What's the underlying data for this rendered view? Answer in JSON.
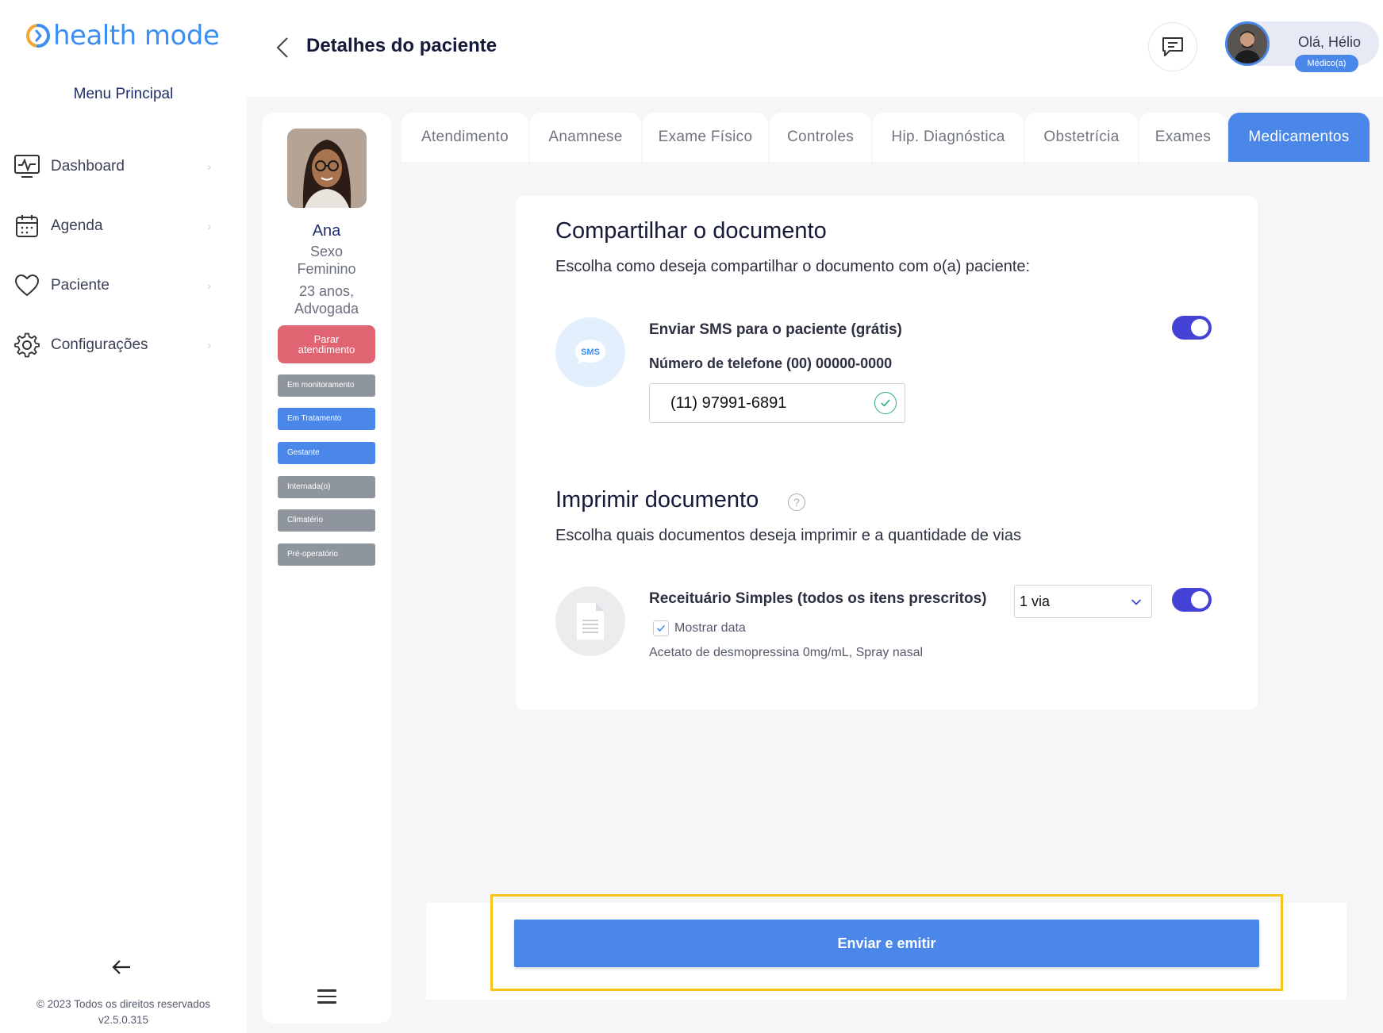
{
  "brand": {
    "name": "health mode",
    "color": "#3b8ff3"
  },
  "sidebar": {
    "menu_title": "Menu Principal",
    "items": [
      {
        "label": "Dashboard",
        "icon": "monitor-icon"
      },
      {
        "label": "Agenda",
        "icon": "calendar-icon"
      },
      {
        "label": "Paciente",
        "icon": "heart-icon"
      },
      {
        "label": "Configurações",
        "icon": "gear-icon"
      }
    ],
    "copyright": "© 2023 Todos os direitos reservados",
    "version": "v2.5.0.315"
  },
  "header": {
    "title": "Detalhes do paciente",
    "greeting": "Olá, Hélio",
    "role": "Médico(a)"
  },
  "patient": {
    "name": "Ana",
    "sex_label": "Sexo",
    "sex": "Feminino",
    "age": "23 anos,",
    "occupation": "Advogada",
    "stop_button": "Parar atendimento",
    "tags": [
      {
        "label": "Em monitoramento",
        "color": "#8f959c"
      },
      {
        "label": "Em Tratamento",
        "color": "#4a87e8"
      },
      {
        "label": "Gestante",
        "color": "#4a87e8"
      },
      {
        "label": "Internada(o)",
        "color": "#8f959c"
      },
      {
        "label": "Climatério",
        "color": "#8f959c"
      },
      {
        "label": "Pré-operatório",
        "color": "#8f959c"
      }
    ]
  },
  "tabs": [
    {
      "label": "Atendimento",
      "active": false
    },
    {
      "label": "Anamnese",
      "active": false
    },
    {
      "label": "Exame Físico",
      "active": false
    },
    {
      "label": "Controles",
      "active": false
    },
    {
      "label": "Hip. Diagnóstica",
      "active": false
    },
    {
      "label": "Obstetrícia",
      "active": false
    },
    {
      "label": "Exames",
      "active": false
    },
    {
      "label": "Medicamentos",
      "active": true
    }
  ],
  "share": {
    "title": "Compartilhar o documento",
    "description": "Escolha como deseja compartilhar o documento com o(a) paciente:",
    "sms_badge": "SMS",
    "sms_label": "Enviar SMS para o paciente (grátis)",
    "phone_label": "Número de telefone (00) 00000-0000",
    "phone_value": "(11) 97991-6891",
    "sms_enabled": true
  },
  "print": {
    "title": "Imprimir documento",
    "description": "Escolha quais documentos deseja imprimir e a quantidade de vias",
    "doc_label": "Receituário Simples (todos os itens prescritos)",
    "copies": "1 via",
    "show_date_label": "Mostrar data",
    "show_date_checked": true,
    "items_text": "Acetato de desmopressina 0mg/mL, Spray nasal",
    "print_enabled": true
  },
  "footer": {
    "submit_label": "Enviar e emitir"
  },
  "colors": {
    "accent": "#4a87e8",
    "toggle": "#4542d6",
    "danger": "#e06472",
    "highlight": "#f5c518"
  }
}
